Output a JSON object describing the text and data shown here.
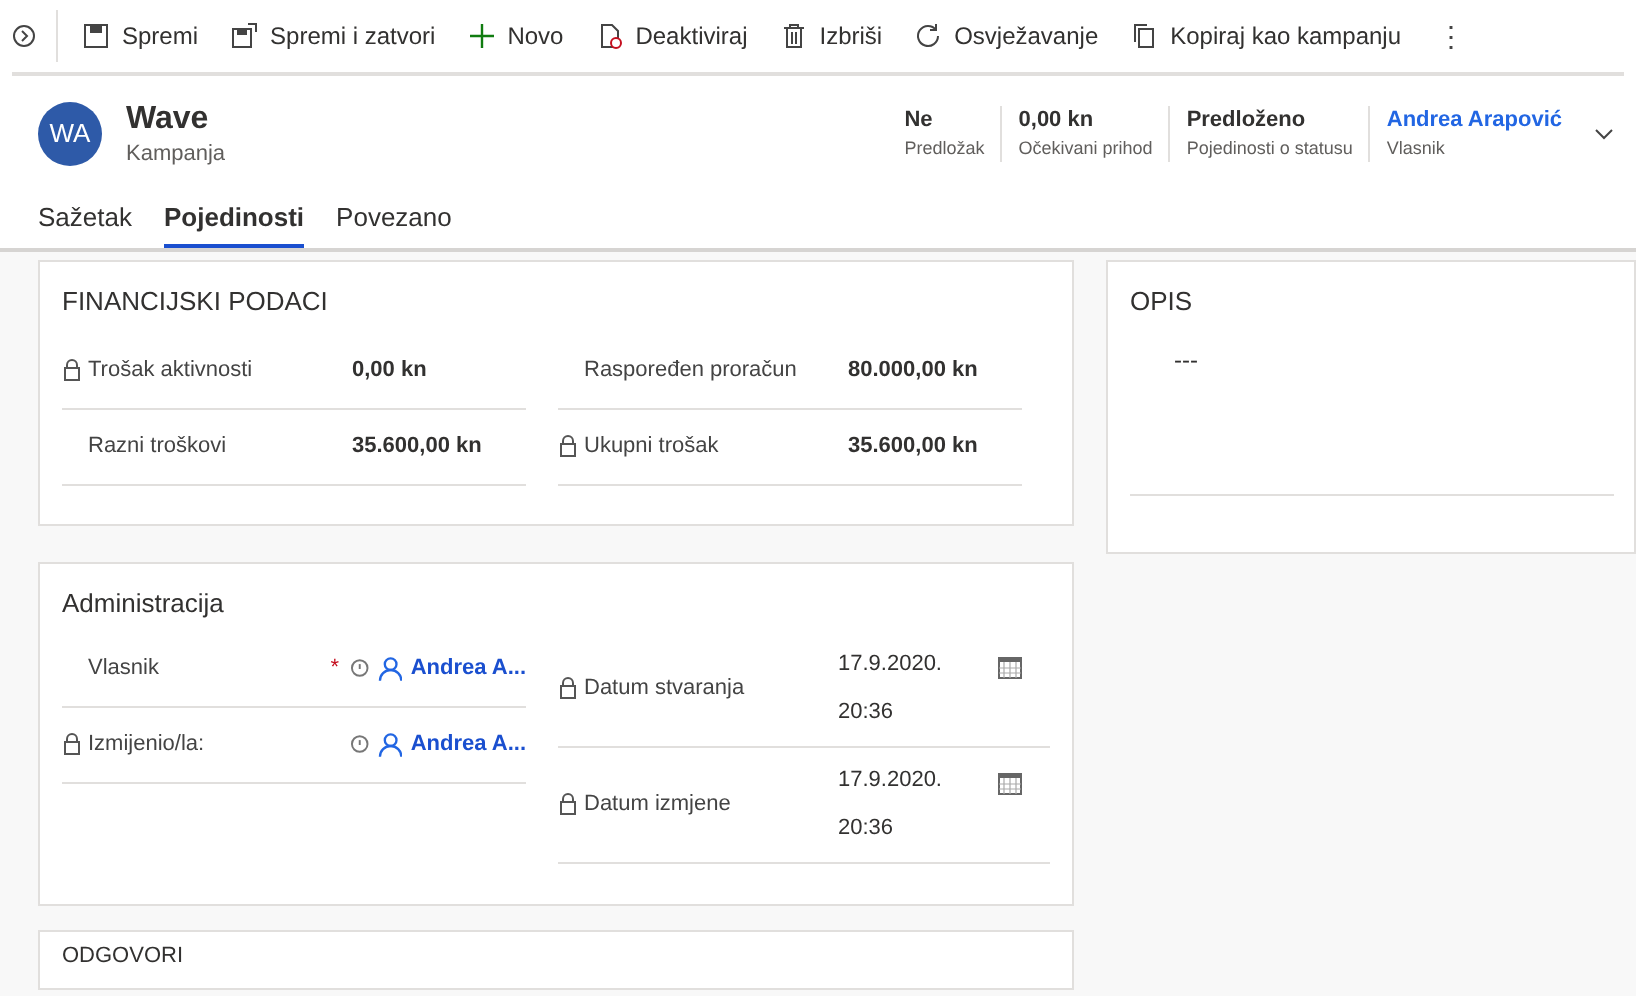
{
  "toolbar": [
    {
      "kind": "save",
      "label": "Spremi"
    },
    {
      "kind": "save-close",
      "label": "Spremi i zatvori"
    },
    {
      "kind": "new",
      "label": "Novo"
    },
    {
      "kind": "deactivate",
      "label": "Deaktiviraj"
    },
    {
      "kind": "delete",
      "label": "Izbriši"
    },
    {
      "kind": "refresh",
      "label": "Osvježavanje"
    },
    {
      "kind": "copy",
      "label": "Kopiraj kao kampanju"
    },
    {
      "kind": "more",
      "label": "⋮"
    }
  ],
  "record": {
    "initials": "WA",
    "title": "Wave",
    "entity": "Kampanja"
  },
  "header_fields": [
    {
      "value": "Ne",
      "label": "Predložak",
      "link": false
    },
    {
      "value": "0,00 kn",
      "label": "Očekivani prihod",
      "link": false
    },
    {
      "value": "Predloženo",
      "label": "Pojedinosti o statusu",
      "link": false
    },
    {
      "value": "Andrea Arapović",
      "label": "Vlasnik",
      "link": true
    }
  ],
  "tabs": [
    {
      "label": "Sažetak",
      "selected": false
    },
    {
      "label": "Pojedinosti",
      "selected": true
    },
    {
      "label": "Povezano",
      "selected": false
    }
  ],
  "financial": {
    "title": "FINANCIJSKI PODACI",
    "columns": [
      [
        {
          "label": "Trošak aktivnosti",
          "value": "0,00 kn",
          "locked": true
        },
        {
          "label": "Razni troškovi",
          "value": "35.600,00 kn",
          "locked": false
        }
      ],
      [
        {
          "label": "Raspoređen proračun",
          "value": "80.000,00 kn",
          "locked": false
        },
        {
          "label": "Ukupni trošak",
          "value": "35.600,00 kn",
          "locked": true
        }
      ]
    ]
  },
  "administration": {
    "title": "Administracija",
    "left": [
      {
        "label": "Vlasnik",
        "value": "Andrea A...",
        "locked": false,
        "required_mark": "*"
      },
      {
        "label": "Izmijenio/la:",
        "value": "Andrea A...",
        "locked": true
      }
    ],
    "right": [
      {
        "label": "Datum stvaranja",
        "date": "17.9.2020.",
        "time": "20:36",
        "locked": true
      },
      {
        "label": "Datum izmjene",
        "date": "17.9.2020.",
        "time": "20:36",
        "locked": true
      }
    ]
  },
  "description": {
    "title": "OPIS",
    "value": "---"
  },
  "responses": {
    "title": "ODGOVORI"
  }
}
